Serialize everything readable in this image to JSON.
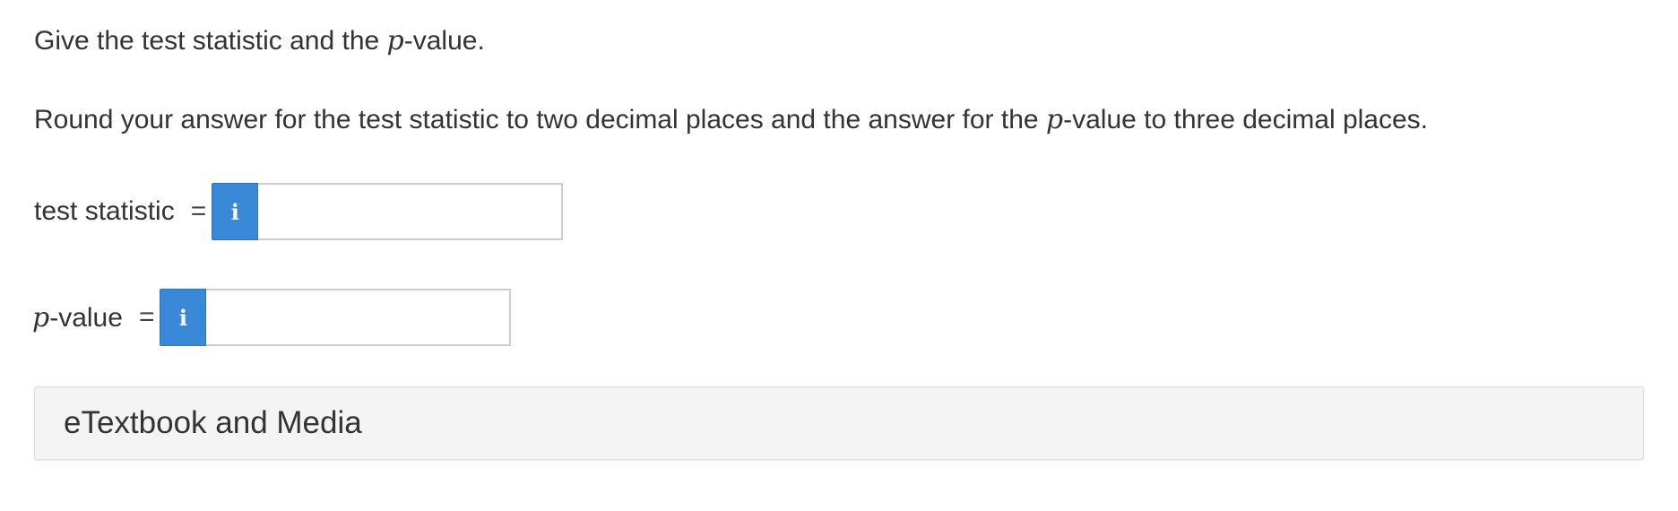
{
  "question": {
    "line1": {
      "before": "Give the test statistic and the ",
      "var": "p",
      "after": "-value."
    },
    "line2": {
      "before": "Round your answer for the test statistic to two decimal places and the answer for the ",
      "var": "p",
      "after": "-value to three decimal places."
    }
  },
  "answers": [
    {
      "label": "test statistic",
      "equals": "=",
      "info_icon": "i",
      "value": ""
    },
    {
      "label_var": "p",
      "label_after": "-value",
      "equals": "=",
      "info_icon": "i",
      "value": ""
    }
  ],
  "etextbook": {
    "label": "eTextbook and Media"
  },
  "colors": {
    "info_button": "#3a89d9",
    "text": "#333333",
    "panel_bg": "#f4f4f4"
  },
  "icons": {
    "info": "info-icon"
  }
}
